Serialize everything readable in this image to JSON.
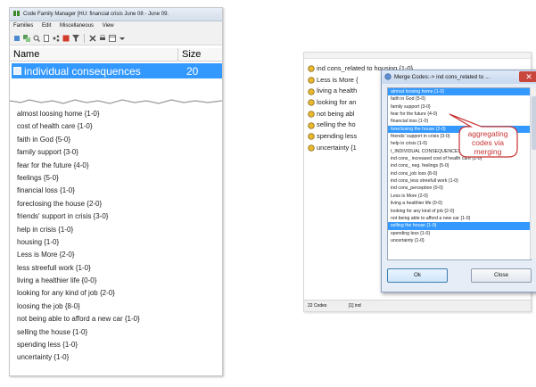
{
  "left_window": {
    "title": "Code Family Manager [HU: financial crisis June 08 - June 09.",
    "menu": [
      "Families",
      "Edit",
      "Miscellaneous",
      "View"
    ],
    "list_headers": {
      "name": "Name",
      "size": "Size"
    },
    "family": {
      "name": "individual consequences",
      "size": "20"
    },
    "codes": [
      "almost loosing home {1-0}",
      "cost of health care {1-0}",
      "faith in God {5-0}",
      "family support {3-0}",
      "fear for the future {4-0}",
      "feelings {5-0}",
      "financial loss {1-0}",
      "foreclosing the house {2-0}",
      "friends' support in crisis {3-0}",
      "help in crisis {1-0}",
      "housing {1-0}",
      "Less is More {2-0}",
      "less streefull work {1-0}",
      "living a healthier life {0-0}",
      "looking for any kind of job {2-0}",
      "loosing the job {8-0}",
      "not being able to afford a new car {1-0}",
      "selling the house {1-0}",
      "spending less {1-0}",
      "uncertainty {1-0}"
    ]
  },
  "right_window": {
    "codes": [
      "ind cons_related to  housing {1-0}",
      "Less is More {",
      "living a health",
      "looking for an",
      "not being abl",
      "selling the ho",
      "spending less",
      "uncertainty {1"
    ],
    "status": {
      "count": "22 Codes",
      "info": "[1] ind"
    }
  },
  "merge_dialog": {
    "title": "Merge Codes:-> ind cons_related to ...",
    "close_symbol": "✕",
    "items": [
      "almost loosing home {1-0}",
      "faith in God {5-0}",
      "family support {3-0}",
      "fear for the future {4-0}",
      "financial loss {1-0}",
      "foreclosing the house {2-0}",
      "friends' support in crisis {3-0}",
      "help in crisis {1-0}",
      "I_INDIVIDUAL CONSEQUENCES {0-0}",
      "ind cons_ increased cost of health care {1-0}",
      "ind cons_ neg. feelings {5-0}",
      "ind cons_job loss {8-0}",
      "ind cons_less streefull work {1-0}",
      "ind cons_perception {0-0}",
      "Less is More {2-0}",
      "living a healthier life {0-0}",
      "looking for any kind of job {2-0}",
      "not being able to afford a new car {1-0}",
      "selling the house {1-0}",
      "spending less {1-0}",
      "uncertainty {1-0}"
    ],
    "selected_indices": [
      0,
      5,
      18
    ],
    "ok_label": "Ok",
    "close_label": "Close"
  },
  "annotation": {
    "text": "aggregating codes via merging",
    "color": "#c83232"
  },
  "colors": {
    "selection": "#3399ff",
    "code_icon": "#e8b830"
  }
}
